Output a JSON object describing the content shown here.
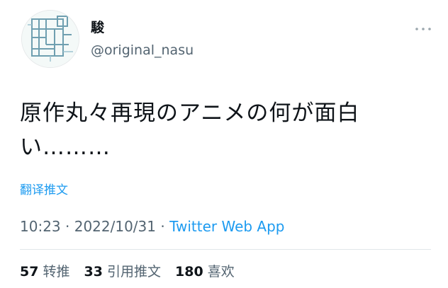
{
  "user": {
    "display_name": "駿",
    "handle": "@original_nasu"
  },
  "more_icon": "more-horizontal-icon",
  "tweet": {
    "text_line1": "原作丸々再現のアニメの何が面白",
    "text_line2": "い………",
    "translate_label": "翻译推文"
  },
  "meta": {
    "time": "10:23",
    "sep1": " · ",
    "date": "2022/10/31",
    "sep2": " · ",
    "source": "Twitter Web App"
  },
  "stats": {
    "retweets_count": "57",
    "retweets_label": "转推",
    "quotes_count": "33",
    "quotes_label": "引用推文",
    "likes_count": "180",
    "likes_label": "喜欢"
  },
  "colors": {
    "link": "#1d9bf0",
    "secondary": "#536471",
    "primary": "#0f1419",
    "divider": "#e1e6e9"
  }
}
